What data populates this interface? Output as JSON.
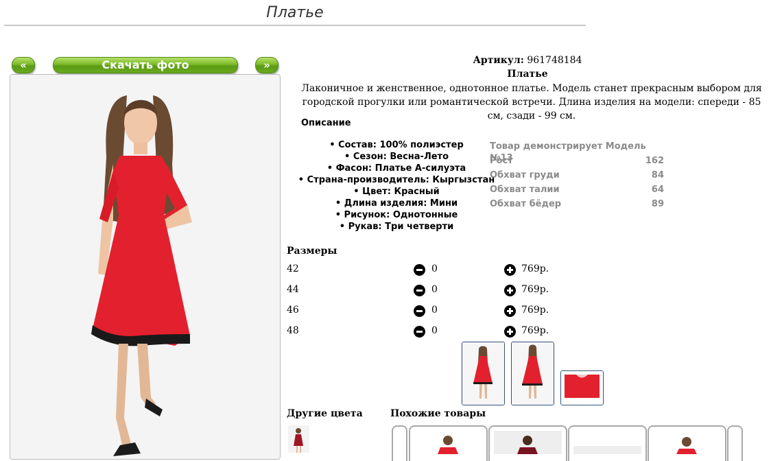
{
  "page": {
    "title": "Платье"
  },
  "gallery": {
    "prev_label": "«",
    "next_label": "»",
    "download_label": "Скачать фото"
  },
  "product": {
    "sku_label": "Артикул:",
    "sku": "961748184",
    "name": "Платье",
    "description": "Лаконичное и женственное, однотонное платье. Модель станет прекрасным выбором для городской прогулки или романтической встречи. Длина изделия на модели: спереди - 85 см, сзади - 99 см.",
    "description_heading": "Описание",
    "specs": [
      "Состав: 100% полиэстер",
      "Сезон: Весна-Лето",
      "Фасон: Платье А-силуэта",
      "Страна-производитель: Кыргызстан",
      "Цвет: Красный",
      "Длина изделия: Мини",
      "Рисунок: Однотонные",
      "Рукав: Три четверти"
    ],
    "model": {
      "title": "Товар демонстрирует Модель №13",
      "rows": [
        {
          "label": "Рост",
          "value": "162"
        },
        {
          "label": "Обхват груди",
          "value": "84"
        },
        {
          "label": "Обхват талии",
          "value": "64"
        },
        {
          "label": "Обхват бёдер",
          "value": "89"
        }
      ]
    }
  },
  "sizes": {
    "heading": "Размеры",
    "rows": [
      {
        "size": "42",
        "qty": "0",
        "price": "769р."
      },
      {
        "size": "44",
        "qty": "0",
        "price": "769р."
      },
      {
        "size": "46",
        "qty": "0",
        "price": "769р."
      },
      {
        "size": "48",
        "qty": "0",
        "price": "769р."
      }
    ]
  },
  "sections": {
    "other_colors": "Другие цвета",
    "similar": "Похожие товары"
  },
  "colors": {
    "accent_green": "#6aaa20",
    "dress_red": "#e3202e",
    "thumb_border": "#33517a"
  }
}
